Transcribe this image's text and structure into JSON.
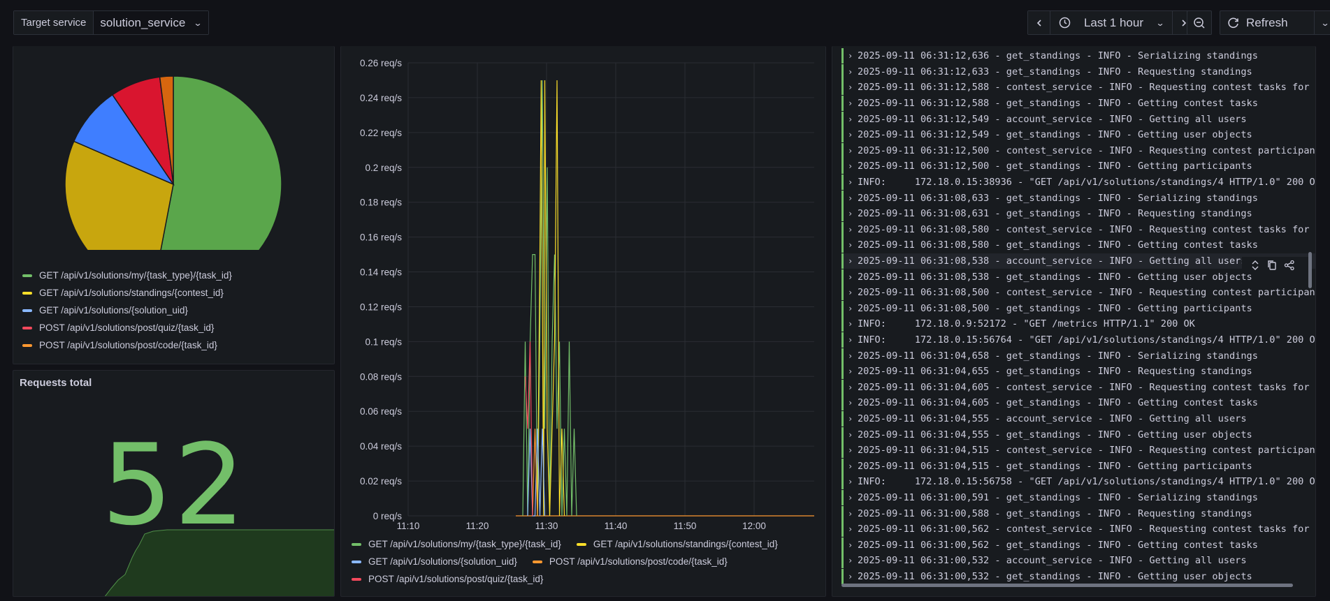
{
  "topbar": {
    "variable_label": "Target service",
    "variable_value": "solution_service",
    "time_range": "Last 1 hour",
    "refresh_label": "Refresh"
  },
  "colors": {
    "green": "#73bf69",
    "yellow": "#fade2a",
    "blue": "#8ab8ff",
    "red": "#f2495c",
    "orange": "#ff9830"
  },
  "pie_panel": {
    "legend": [
      {
        "label": "GET /api/v1/solutions/my/{task_type}/{task_id}",
        "color": "#73bf69"
      },
      {
        "label": "GET /api/v1/solutions/standings/{contest_id}",
        "color": "#fade2a"
      },
      {
        "label": "GET /api/v1/solutions/{solution_uid}",
        "color": "#8ab8ff"
      },
      {
        "label": "POST /api/v1/solutions/post/quiz/{task_id}",
        "color": "#f2495c"
      },
      {
        "label": "POST /api/v1/solutions/post/code/{task_id}",
        "color": "#ff9830"
      }
    ],
    "chart_data": {
      "type": "pie",
      "slices": [
        {
          "name": "GET /api/v1/solutions/my/{task_type}/{task_id}",
          "value": 53.0,
          "color": "#5aa64b"
        },
        {
          "name": "GET /api/v1/solutions/standings/{contest_id}",
          "value": 28.5,
          "color": "#c8a60e"
        },
        {
          "name": "GET /api/v1/solutions/{solution_uid}",
          "value": 9.0,
          "color": "#3f7eff"
        },
        {
          "name": "POST /api/v1/solutions/post/quiz/{task_id}",
          "value": 7.5,
          "color": "#d9152f"
        },
        {
          "name": "POST /api/v1/solutions/post/code/{task_id}",
          "value": 2.0,
          "color": "#d7660f"
        }
      ]
    }
  },
  "stat_panel": {
    "title": "Requests total",
    "value": "52"
  },
  "rate_panel": {
    "chart_data": {
      "type": "line",
      "y_ticks": [
        "0.26 req/s",
        "0.24 req/s",
        "0.22 req/s",
        "0.2 req/s",
        "0.18 req/s",
        "0.16 req/s",
        "0.14 req/s",
        "0.12 req/s",
        "0.1 req/s",
        "0.08 req/s",
        "0.06 req/s",
        "0.04 req/s",
        "0.02 req/s",
        "0 req/s"
      ],
      "x_ticks": [
        "11:10",
        "11:20",
        "11:30",
        "11:40",
        "11:50",
        "12:00"
      ],
      "ylim": [
        0,
        0.26
      ],
      "series": [
        {
          "name": "GET /api/v1/solutions/my/{task_type}/{task_id}",
          "color": "#73bf69",
          "points": [
            [
              11.6,
              0
            ],
            [
              11.7,
              0.1
            ],
            [
              11.8,
              0
            ],
            [
              11.9,
              0.1
            ],
            [
              12.0,
              0.15
            ],
            [
              12.1,
              0.15
            ],
            [
              12.2,
              0
            ],
            [
              12.3,
              0.1
            ],
            [
              12.4,
              0.25
            ],
            [
              12.5,
              0.05
            ],
            [
              12.6,
              0.2
            ],
            [
              12.7,
              0
            ],
            [
              12.8,
              0.1
            ],
            [
              12.9,
              0.15
            ],
            [
              13.0,
              0.05
            ],
            [
              13.1,
              0.1
            ],
            [
              13.2,
              0
            ],
            [
              13.3,
              0.05
            ],
            [
              13.4,
              0
            ],
            [
              13.5,
              0.1
            ],
            [
              13.6,
              0
            ],
            [
              13.7,
              0.05
            ],
            [
              13.8,
              0
            ]
          ]
        },
        {
          "name": "GET /api/v1/solutions/standings/{contest_id}",
          "color": "#fade2a",
          "points": [
            [
              12.2,
              0
            ],
            [
              12.3,
              0.15
            ],
            [
              12.35,
              0.25
            ],
            [
              12.45,
              0
            ],
            [
              12.5,
              0.25
            ],
            [
              12.6,
              0.05
            ],
            [
              12.7,
              0
            ],
            [
              12.8,
              0.05
            ],
            [
              12.9,
              0.1
            ],
            [
              13.0,
              0.25
            ],
            [
              13.1,
              0
            ],
            [
              13.2,
              0.05
            ],
            [
              13.3,
              0
            ]
          ]
        },
        {
          "name": "GET /api/v1/solutions/{solution_uid}",
          "color": "#8ab8ff",
          "points": [
            [
              11.8,
              0
            ],
            [
              11.9,
              0.05
            ],
            [
              12.0,
              0
            ],
            [
              12.1,
              0
            ],
            [
              12.2,
              0.05
            ],
            [
              12.3,
              0
            ],
            [
              12.4,
              0.05
            ],
            [
              12.5,
              0
            ]
          ]
        },
        {
          "name": "POST /api/v1/solutions/post/code/{task_id}",
          "color": "#ff9830",
          "points": [
            [
              12.0,
              0
            ],
            [
              12.1,
              0.05
            ],
            [
              12.2,
              0
            ]
          ]
        },
        {
          "name": "POST /api/v1/solutions/post/quiz/{task_id}",
          "color": "#f2495c",
          "points": [
            [
              11.7,
              0.08
            ],
            [
              11.8,
              0.05
            ],
            [
              11.9,
              0.1
            ],
            [
              12.0,
              0
            ]
          ]
        }
      ]
    },
    "legend": [
      {
        "label": "GET /api/v1/solutions/my/{task_type}/{task_id}",
        "color": "#73bf69"
      },
      {
        "label": "GET /api/v1/solutions/standings/{contest_id}",
        "color": "#fade2a"
      },
      {
        "label": "GET /api/v1/solutions/{solution_uid}",
        "color": "#8ab8ff"
      },
      {
        "label": "POST /api/v1/solutions/post/code/{task_id}",
        "color": "#ff9830"
      },
      {
        "label": "POST /api/v1/solutions/post/quiz/{task_id}",
        "color": "#f2495c"
      }
    ]
  },
  "logs": [
    "2025-09-11 06:31:12,636 - get_standings - INFO - Serializing standings",
    "2025-09-11 06:31:12,633 - get_standings - INFO - Requesting standings",
    "2025-09-11 06:31:12,588 - contest_service - INFO - Requesting contest tasks for",
    "2025-09-11 06:31:12,588 - get_standings - INFO - Getting contest tasks",
    "2025-09-11 06:31:12,549 - account_service - INFO - Getting all users",
    "2025-09-11 06:31:12,549 - get_standings - INFO - Getting user objects",
    "2025-09-11 06:31:12,500 - contest_service - INFO - Requesting contest participan",
    "2025-09-11 06:31:12,500 - get_standings - INFO - Getting participants",
    "INFO:     172.18.0.15:38936 - \"GET /api/v1/solutions/standings/4 HTTP/1.0\" 200 O",
    "2025-09-11 06:31:08,633 - get_standings - INFO - Serializing standings",
    "2025-09-11 06:31:08,631 - get_standings - INFO - Requesting standings",
    "2025-09-11 06:31:08,580 - contest_service - INFO - Requesting contest tasks for",
    "2025-09-11 06:31:08,580 - get_standings - INFO - Getting contest tasks",
    "2025-09-11 06:31:08,538 - account_service - INFO - Getting all users",
    "2025-09-11 06:31:08,538 - get_standings - INFO - Getting user objects",
    "2025-09-11 06:31:08,500 - contest_service - INFO - Requesting contest participan",
    "2025-09-11 06:31:08,500 - get_standings - INFO - Getting participants",
    "INFO:     172.18.0.9:52172 - \"GET /metrics HTTP/1.1\" 200 OK",
    "INFO:     172.18.0.15:56764 - \"GET /api/v1/solutions/standings/4 HTTP/1.0\" 200 O",
    "2025-09-11 06:31:04,658 - get_standings - INFO - Serializing standings",
    "2025-09-11 06:31:04,655 - get_standings - INFO - Requesting standings",
    "2025-09-11 06:31:04,605 - contest_service - INFO - Requesting contest tasks for",
    "2025-09-11 06:31:04,605 - get_standings - INFO - Getting contest tasks",
    "2025-09-11 06:31:04,555 - account_service - INFO - Getting all users",
    "2025-09-11 06:31:04,555 - get_standings - INFO - Getting user objects",
    "2025-09-11 06:31:04,515 - contest_service - INFO - Requesting contest participan",
    "2025-09-11 06:31:04,515 - get_standings - INFO - Getting participants",
    "INFO:     172.18.0.15:56758 - \"GET /api/v1/solutions/standings/4 HTTP/1.0\" 200 O",
    "2025-09-11 06:31:00,591 - get_standings - INFO - Serializing standings",
    "2025-09-11 06:31:00,588 - get_standings - INFO - Requesting standings",
    "2025-09-11 06:31:00,562 - contest_service - INFO - Requesting contest tasks for",
    "2025-09-11 06:31:00,562 - get_standings - INFO - Getting contest tasks",
    "2025-09-11 06:31:00,532 - account_service - INFO - Getting all users",
    "2025-09-11 06:31:00,532 - get_standings - INFO - Getting user objects"
  ]
}
